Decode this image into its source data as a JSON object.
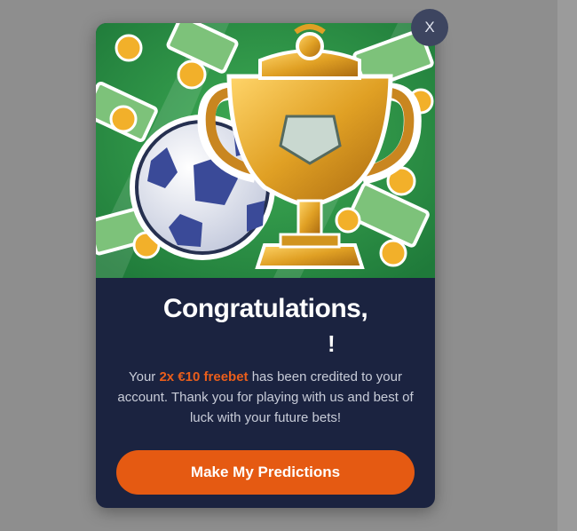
{
  "modal": {
    "close_label": "X",
    "title_line1": "Congratulations,",
    "title_line2": "!",
    "message": {
      "prefix": "Your ",
      "highlight": "2x €10 freebet",
      "suffix": " has been credited to your account. Thank you for playing with us and best of luck with your future bets!"
    },
    "cta_label": "Make My Predictions"
  },
  "colors": {
    "overlay": "#8e8e8e",
    "modal_bg": "#1b2340",
    "accent": "#e55a12",
    "highlight_text": "#ea5e1b",
    "hero_green": "#2f9a4c"
  }
}
